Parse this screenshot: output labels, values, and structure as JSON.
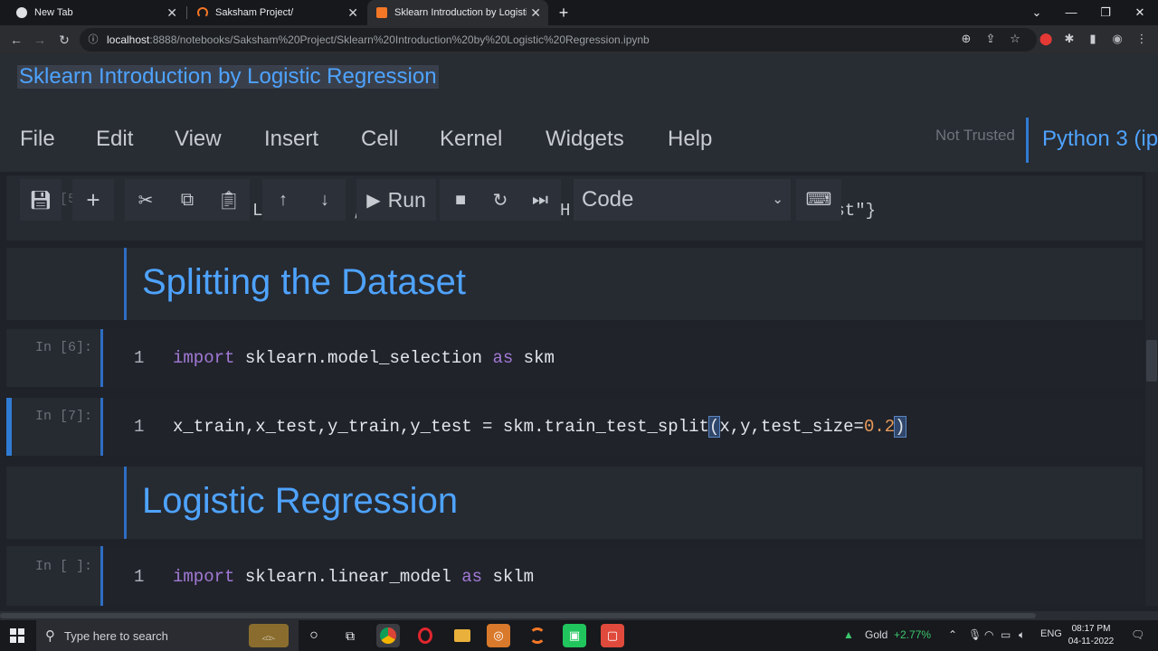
{
  "browser": {
    "tabs": [
      {
        "label": "New Tab"
      },
      {
        "label": "Saksham Project/"
      },
      {
        "label": "Sklearn Introduction by Logistic R"
      }
    ],
    "new_tab_symbol": "+",
    "url_host": "localhost",
    "url_path": ":8888/notebooks/Saksham%20Project/Sklearn%20Introduction%20by%20Logistic%20Regression.ipynb",
    "icons": [
      "back-icon",
      "forward-icon",
      "reload-icon",
      "info-icon",
      "zoom-icon",
      "share-icon",
      "star-icon",
      "extension-icon",
      "puzzle-icon",
      "sidebar-icon",
      "profile-icon",
      "menu-icon"
    ]
  },
  "jupyter": {
    "notebook_title": "Sklearn Introduction by Logistic Regression",
    "menu": [
      "File",
      "Edit",
      "View",
      "Insert",
      "Cell",
      "Kernel",
      "Widgets",
      "Help"
    ],
    "trust_status": "Not Trusted",
    "kernel_name": "Python 3 (ip",
    "toolbar": {
      "run_label": "Run",
      "cell_type": "Code"
    },
    "accent_color": "#4ea3ff"
  },
  "cells": {
    "prev_cell": {
      "prompt": "In [5]:",
      "code_fragment_left": "L",
      "code_fragment_comma": ",",
      "code_fragment_mid": "H:",
      "code_fragment_right": "i",
      "code_fragment_end": "ost\"}"
    },
    "md1": {
      "text": "Splitting the Dataset"
    },
    "c6": {
      "prompt": "In [6]:",
      "line": "1",
      "kw1": "import",
      "mod": " sklearn.model_selection ",
      "kw2": "as",
      "alias": " skm"
    },
    "c7": {
      "prompt": "In [7]:",
      "line": "1",
      "code_a": "x_train,x_test,y_train,y_test = skm.train_test_split",
      "open": "(",
      "code_b": "x,y,test_size=",
      "num": "0.2",
      "close": ")"
    },
    "md2": {
      "text": "Logistic Regression"
    },
    "c8": {
      "prompt": "In [ ]:",
      "line": "1",
      "kw1": "import",
      "mod": " sklearn.linear_model ",
      "kw2": "as",
      "alias": " sklm"
    }
  },
  "taskbar": {
    "search_placeholder": "Type here to search",
    "stock_name": "Gold",
    "stock_change": "+2.77%",
    "language": "ENG",
    "time": "08:17 PM",
    "date": "04-11-2022"
  }
}
